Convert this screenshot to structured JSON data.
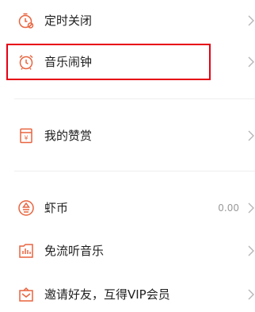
{
  "menu": {
    "timer_off": {
      "label": "定时关闭",
      "icon": "timer-icon"
    },
    "music_alarm": {
      "label": "音乐闹钟",
      "icon": "alarm-clock-icon"
    },
    "my_tips": {
      "label": "我的赞赏",
      "icon": "tip-envelope-icon"
    },
    "shrimp_coin": {
      "label": "虾币",
      "value": "0.00",
      "icon": "coin-icon"
    },
    "free_data": {
      "label": "免流听音乐",
      "icon": "data-free-icon"
    },
    "invite": {
      "label": "邀请好友，互得VIP会员",
      "icon": "gift-icon"
    }
  },
  "colors": {
    "accent": "#e8643f",
    "highlight": "#e60012",
    "chevron": "#b5b5b5",
    "divider": "#eeeeee"
  }
}
